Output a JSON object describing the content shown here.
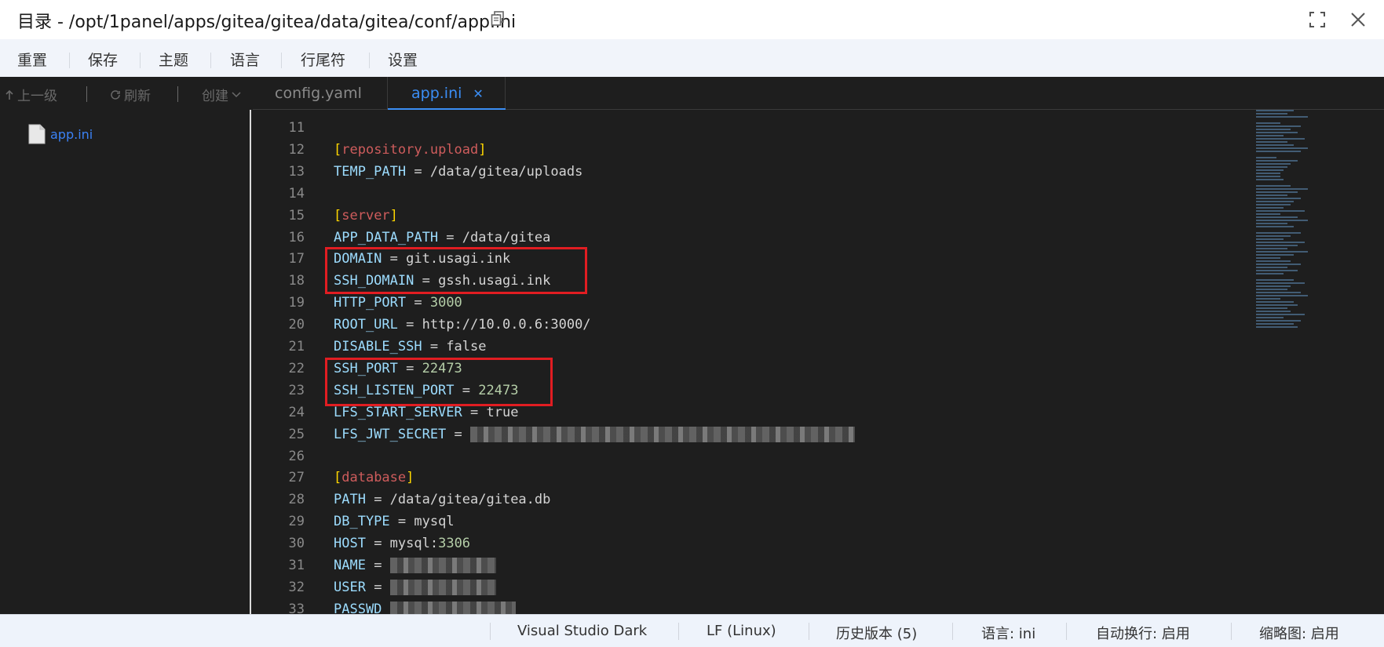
{
  "window": {
    "title": "目录 - /opt/1panel/apps/gitea/gitea/data/gitea/conf/app.ini"
  },
  "menu": {
    "items": [
      "重置",
      "保存",
      "主题",
      "语言",
      "行尾符",
      "设置"
    ]
  },
  "sidebar": {
    "up_label": "上一级",
    "refresh_label": "刷新",
    "create_label": "创建",
    "files": [
      "app.ini"
    ]
  },
  "tabs": [
    {
      "label": "config.yaml",
      "active": false
    },
    {
      "label": "app.ini",
      "active": true
    }
  ],
  "code": {
    "lines": [
      {
        "n": "11",
        "kind": "blank"
      },
      {
        "n": "12",
        "kind": "section",
        "name": "repository.upload"
      },
      {
        "n": "13",
        "kind": "kv",
        "key": "TEMP_PATH",
        "value": "/data/gitea/uploads"
      },
      {
        "n": "14",
        "kind": "blank"
      },
      {
        "n": "15",
        "kind": "section",
        "name": "server"
      },
      {
        "n": "16",
        "kind": "kv",
        "key": "APP_DATA_PATH",
        "value": "/data/gitea"
      },
      {
        "n": "17",
        "kind": "kv",
        "key": "DOMAIN",
        "value": "git.usagi.ink"
      },
      {
        "n": "18",
        "kind": "kv",
        "key": "SSH_DOMAIN",
        "value": "gssh.usagi.ink"
      },
      {
        "n": "19",
        "kind": "kvnum",
        "key": "HTTP_PORT",
        "value": "3000"
      },
      {
        "n": "20",
        "kind": "kv",
        "key": "ROOT_URL",
        "value": "http://10.0.0.6:3000/"
      },
      {
        "n": "21",
        "kind": "kv",
        "key": "DISABLE_SSH",
        "value": "false"
      },
      {
        "n": "22",
        "kind": "kvnum",
        "key": "SSH_PORT",
        "value": "22473"
      },
      {
        "n": "23",
        "kind": "kvnum",
        "key": "SSH_LISTEN_PORT",
        "value": "22473"
      },
      {
        "n": "24",
        "kind": "kv",
        "key": "LFS_START_SERVER",
        "value": "true"
      },
      {
        "n": "25",
        "kind": "kvblur",
        "key": "LFS_JWT_SECRET",
        "value": ""
      },
      {
        "n": "26",
        "kind": "blank"
      },
      {
        "n": "27",
        "kind": "section",
        "name": "database"
      },
      {
        "n": "28",
        "kind": "kv",
        "key": "PATH",
        "value": "/data/gitea/gitea.db"
      },
      {
        "n": "29",
        "kind": "kv",
        "key": "DB_TYPE",
        "value": "mysql"
      },
      {
        "n": "30",
        "kind": "kvnum2",
        "key": "HOST",
        "value": "mysql:",
        "num": "3306"
      },
      {
        "n": "31",
        "kind": "kvblur",
        "key": "NAME",
        "value": ""
      },
      {
        "n": "32",
        "kind": "kvblur",
        "key": "USER",
        "value": ""
      },
      {
        "n": "33",
        "kind": "kvblur",
        "key": "PASSWD",
        "value": ""
      }
    ]
  },
  "status": {
    "items": [
      "Visual Studio Dark",
      "LF (Linux)",
      "历史版本 (5)",
      "语言: ini",
      "自动换行: 启用",
      "缩略图: 启用"
    ]
  },
  "colors": {
    "highlight_box": "#e11d22",
    "editor_bg": "#1e1e1e",
    "accent": "#3b8ef5"
  }
}
